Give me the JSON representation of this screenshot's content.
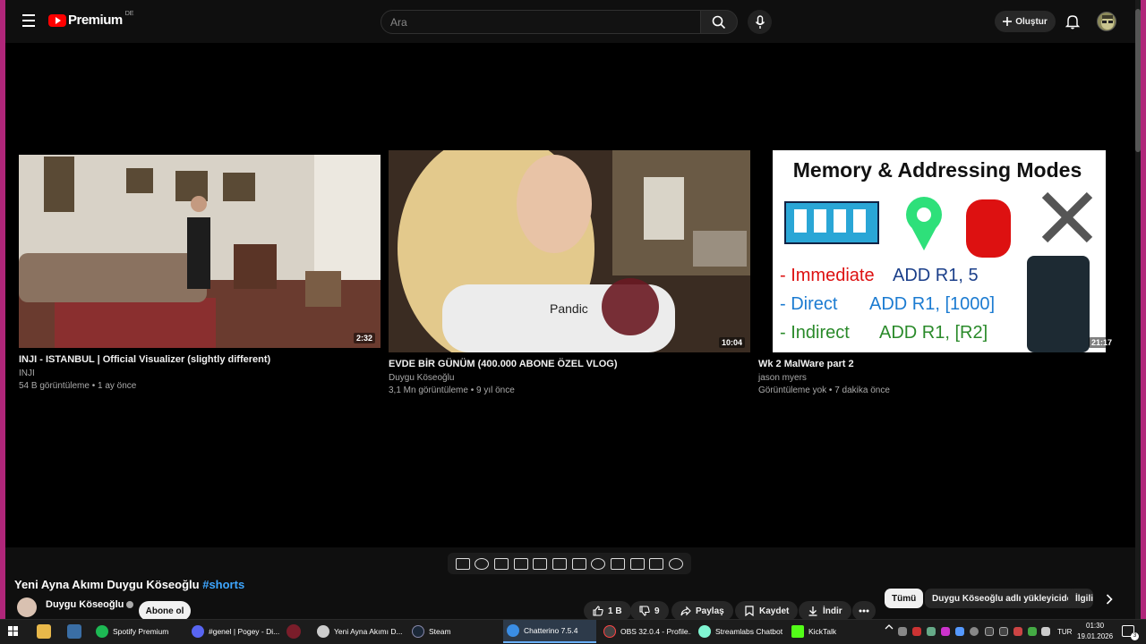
{
  "header": {
    "logo_text": "Premium",
    "logo_region": "DE",
    "search_placeholder": "Ara",
    "create_label": "Oluştur"
  },
  "endscreen": [
    {
      "title": "INJI - ISTANBUL | Official Visualizer (slightly different)",
      "channel": "INJI",
      "meta": "54 B görüntüleme • 1 ay önce",
      "duration": "2:32"
    },
    {
      "title": "EVDE BİR GÜNÜM (400.000 ABONE ÖZEL VLOG)",
      "channel": "Duygu Köseoğlu",
      "meta": "3,1 Mn görüntüleme • 9 yıl önce",
      "duration": "10:04"
    },
    {
      "title": "Wk 2 MalWare part 2",
      "channel": "jason myers",
      "meta": "Görüntüleme yok • 7 dakika önce",
      "duration": "21:17",
      "thumb_text": {
        "heading": "Memory & Addressing Modes",
        "l1a": "- Immediate",
        "l1b": "ADD R1, 5",
        "l2a": "- Direct",
        "l2b": "ADD R1, [1000]",
        "l3a": "- Indirect",
        "l3b": "ADD R1, [R2]"
      }
    }
  ],
  "video": {
    "title": "Yeni Ayna Akımı Duygu Köseoğlu",
    "hashtag": "#shorts",
    "channel": "Duygu Köseoğlu",
    "subscribe_label": "Abone ol",
    "likes": "1 B",
    "dislikes": "9",
    "share_label": "Paylaş",
    "save_label": "Kaydet",
    "download_label": "İndir"
  },
  "chips": [
    "Tümü",
    "Duygu Köseoğlu adlı yükleyiciden",
    "İlgili"
  ],
  "taskbar": {
    "items": [
      {
        "label": "Spotify Premium",
        "color": "#1db954"
      },
      {
        "label": "#genel | Pogey - Di...",
        "color": "#5865f2"
      },
      {
        "label": "Yeni Ayna Akımı D...",
        "color": "#cccccc"
      },
      {
        "label": "Steam",
        "color": "#1b2838"
      },
      {
        "label": "Chatterino 7.5.4",
        "color": "#3a8ee6"
      },
      {
        "label": "OBS 32.0.4 - Profile...",
        "color": "#444444"
      },
      {
        "label": "Streamlabs Chatbot",
        "color": "#80f5d2"
      },
      {
        "label": "KickTalk",
        "color": "#53fc18"
      }
    ],
    "lang": "TUR",
    "time": "01:30",
    "date": "19.01.2026",
    "notif_count": "3"
  }
}
